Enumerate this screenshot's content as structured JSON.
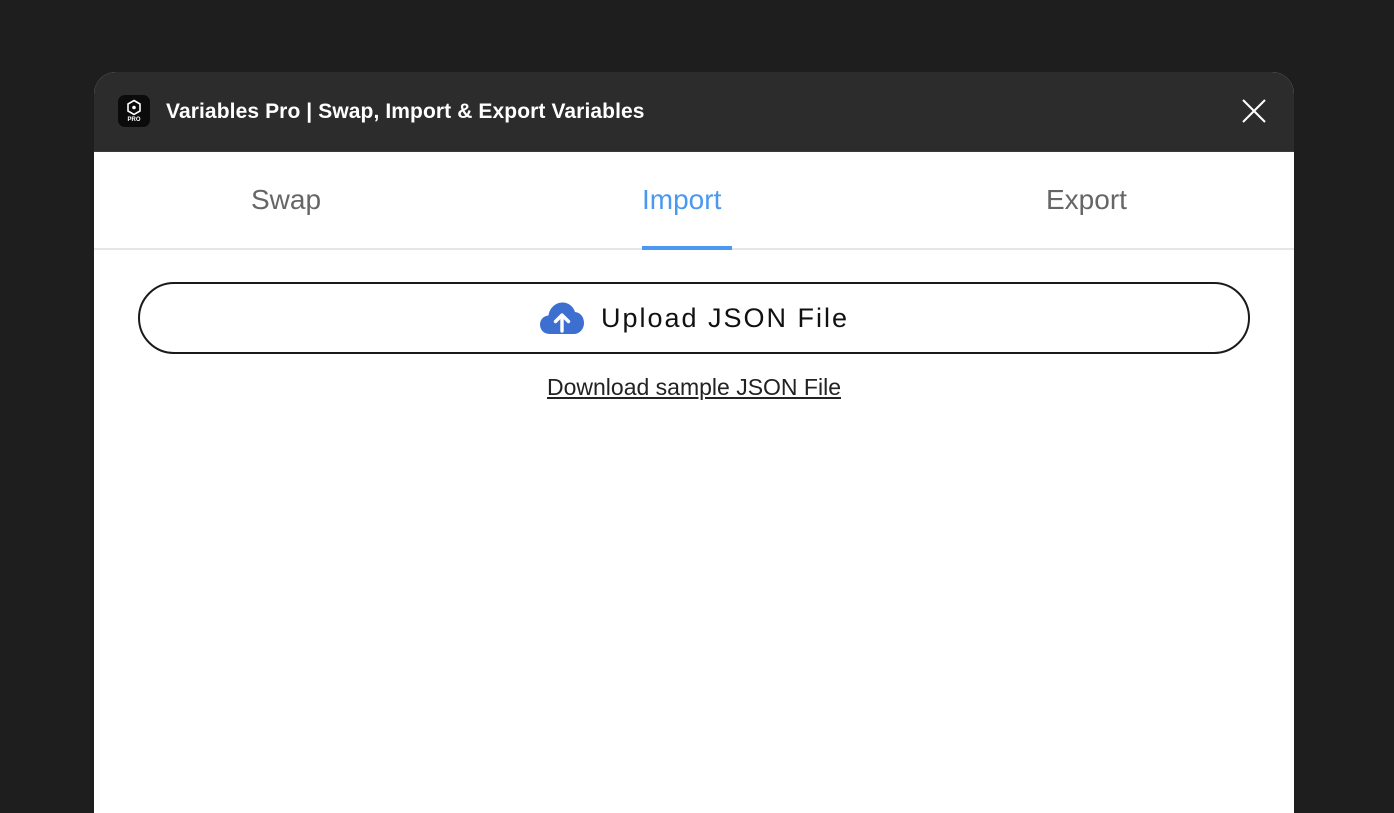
{
  "window": {
    "title": "Variables Pro | Swap, Import & Export Variables",
    "logo_badge": "PRO",
    "logo_icon": "hexagon-dot-icon",
    "close_icon": "close-icon"
  },
  "tabs": [
    {
      "label": "Swap",
      "active": false
    },
    {
      "label": "Import",
      "active": true
    },
    {
      "label": "Export",
      "active": false
    }
  ],
  "import": {
    "upload_button_label": "Upload JSON File",
    "upload_icon": "cloud-upload-icon",
    "sample_link_label": "Download sample JSON File"
  },
  "colors": {
    "accent": "#4a98f0",
    "upload_icon": "#3d6fd1",
    "titlebar": "#2c2c2c",
    "background": "#1e1e1e"
  }
}
